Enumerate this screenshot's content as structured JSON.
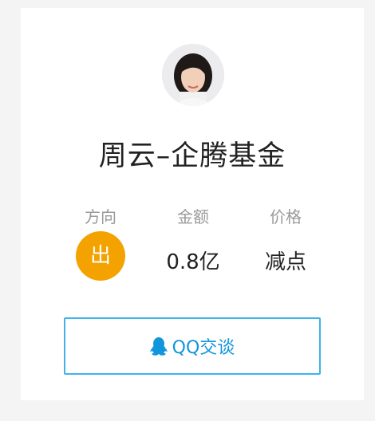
{
  "profile": {
    "name": "周云–企腾基金",
    "avatar_icon": "person-photo"
  },
  "stats": {
    "direction_label": "方向",
    "direction_value": "出",
    "amount_label": "金额",
    "amount_value": "0.8亿",
    "price_label": "价格",
    "price_value": "减点"
  },
  "chat_button": {
    "label": "QQ交谈",
    "icon": "qq-penguin-icon"
  },
  "colors": {
    "accent_orange": "#f4a200",
    "button_border": "#3fb4ea",
    "button_text": "#1296db"
  }
}
